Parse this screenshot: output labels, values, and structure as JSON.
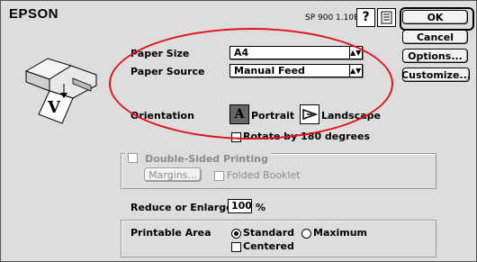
{
  "brand": "EPSON",
  "model": "SP 900 1.10E",
  "buttons": {
    "ok": "OK",
    "cancel": "Cancel",
    "options": "Options...",
    "customize": "Customize..."
  },
  "paper_size": {
    "label": "Paper Size",
    "value": "A4"
  },
  "paper_source": {
    "label": "Paper Source",
    "value": "Manual Feed"
  },
  "orientation": {
    "label": "Orientation",
    "portrait": "Portrait",
    "landscape": "Landscape",
    "selected": "Portrait",
    "rotate_label": "Rotate by 180 degrees",
    "rotate_checked": false
  },
  "double_sided": {
    "label": "Double-Sided Printing",
    "enabled": false,
    "margins_button": "Margins...",
    "folded_booklet": "Folded Booklet"
  },
  "reduce_enlarge": {
    "label": "Reduce or Enlarge",
    "value": "100",
    "unit": "%"
  },
  "printable_area": {
    "label": "Printable Area",
    "standard": "Standard",
    "maximum": "Maximum",
    "selected": "Standard",
    "centered": "Centered",
    "centered_checked": false
  },
  "highlight_color": "#e0141e"
}
